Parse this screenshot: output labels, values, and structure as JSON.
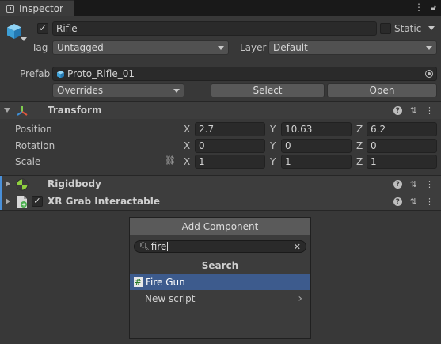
{
  "tab": {
    "title": "Inspector"
  },
  "object": {
    "name": "Rifle",
    "static_label": "Static",
    "tag_label": "Tag",
    "tag_value": "Untagged",
    "layer_label": "Layer",
    "layer_value": "Default",
    "prefab_label": "Prefab",
    "prefab_value": "Proto_Rifle_01",
    "overrides_value": "Overrides",
    "select_label": "Select",
    "open_label": "Open"
  },
  "transform": {
    "title": "Transform",
    "position_label": "Position",
    "rotation_label": "Rotation",
    "scale_label": "Scale",
    "axis_x": "X",
    "axis_y": "Y",
    "axis_z": "Z",
    "position": {
      "x": "2.7",
      "y": "10.63",
      "z": "6.2"
    },
    "rotation": {
      "x": "0",
      "y": "0",
      "z": "0"
    },
    "scale": {
      "x": "1",
      "y": "1",
      "z": "1"
    }
  },
  "components": {
    "rigidbody": "Rigidbody",
    "xr_grab": "XR Grab Interactable"
  },
  "add_component": {
    "title": "Add Component",
    "search_value": "fire",
    "section_title": "Search",
    "items": [
      {
        "label": "Fire Gun",
        "selected": true
      },
      {
        "label": "New script",
        "selected": false
      }
    ]
  },
  "colors": {
    "accent_blue": "#3d5b8d",
    "panel": "#383838",
    "header": "#3d3d3d"
  },
  "icons": {
    "help": "help-icon",
    "presets": "sliders-icon",
    "more": "kebab-menu-icon",
    "link": "link-icon",
    "script": "script-hash-icon",
    "cube": "cube-icon"
  }
}
